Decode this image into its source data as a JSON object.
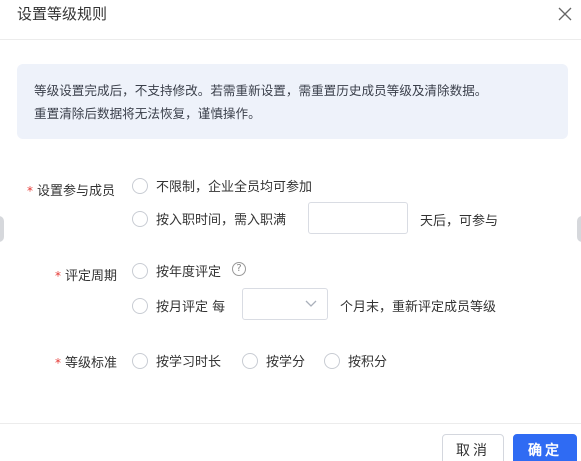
{
  "dialog": {
    "title": "设置等级规则",
    "notice": {
      "line1": "等级设置完成后，不支持修改。若需重新设置，需重置历史成员等级及清除数据。",
      "line2": "重置清除后数据将无法恢复，谨慎操作。"
    },
    "members": {
      "label": "设置参与成员",
      "required_mark": "*",
      "option_unlimited": "不限制，企业全员均可参加",
      "option_tenure_prefix": "按入职时间，需入职满",
      "tenure_value": "",
      "option_tenure_suffix": "天后，可参与"
    },
    "cycle": {
      "label": "评定周期",
      "required_mark": "*",
      "option_yearly": "按年度评定",
      "help_icon_glyph": "?",
      "option_monthly": "按月评定 每",
      "month_select_value": "",
      "option_monthly_suffix": "个月末，重新评定成员等级"
    },
    "standard": {
      "label": "等级标准",
      "required_mark": "*",
      "options": [
        "按学习时长",
        "按学分",
        "按积分"
      ]
    },
    "footer": {
      "cancel_label": "取消",
      "ok_label": "确定"
    },
    "colors": {
      "primary": "#2f6bf3",
      "required": "#e53935",
      "notice_bg": "#eef2fa"
    }
  }
}
